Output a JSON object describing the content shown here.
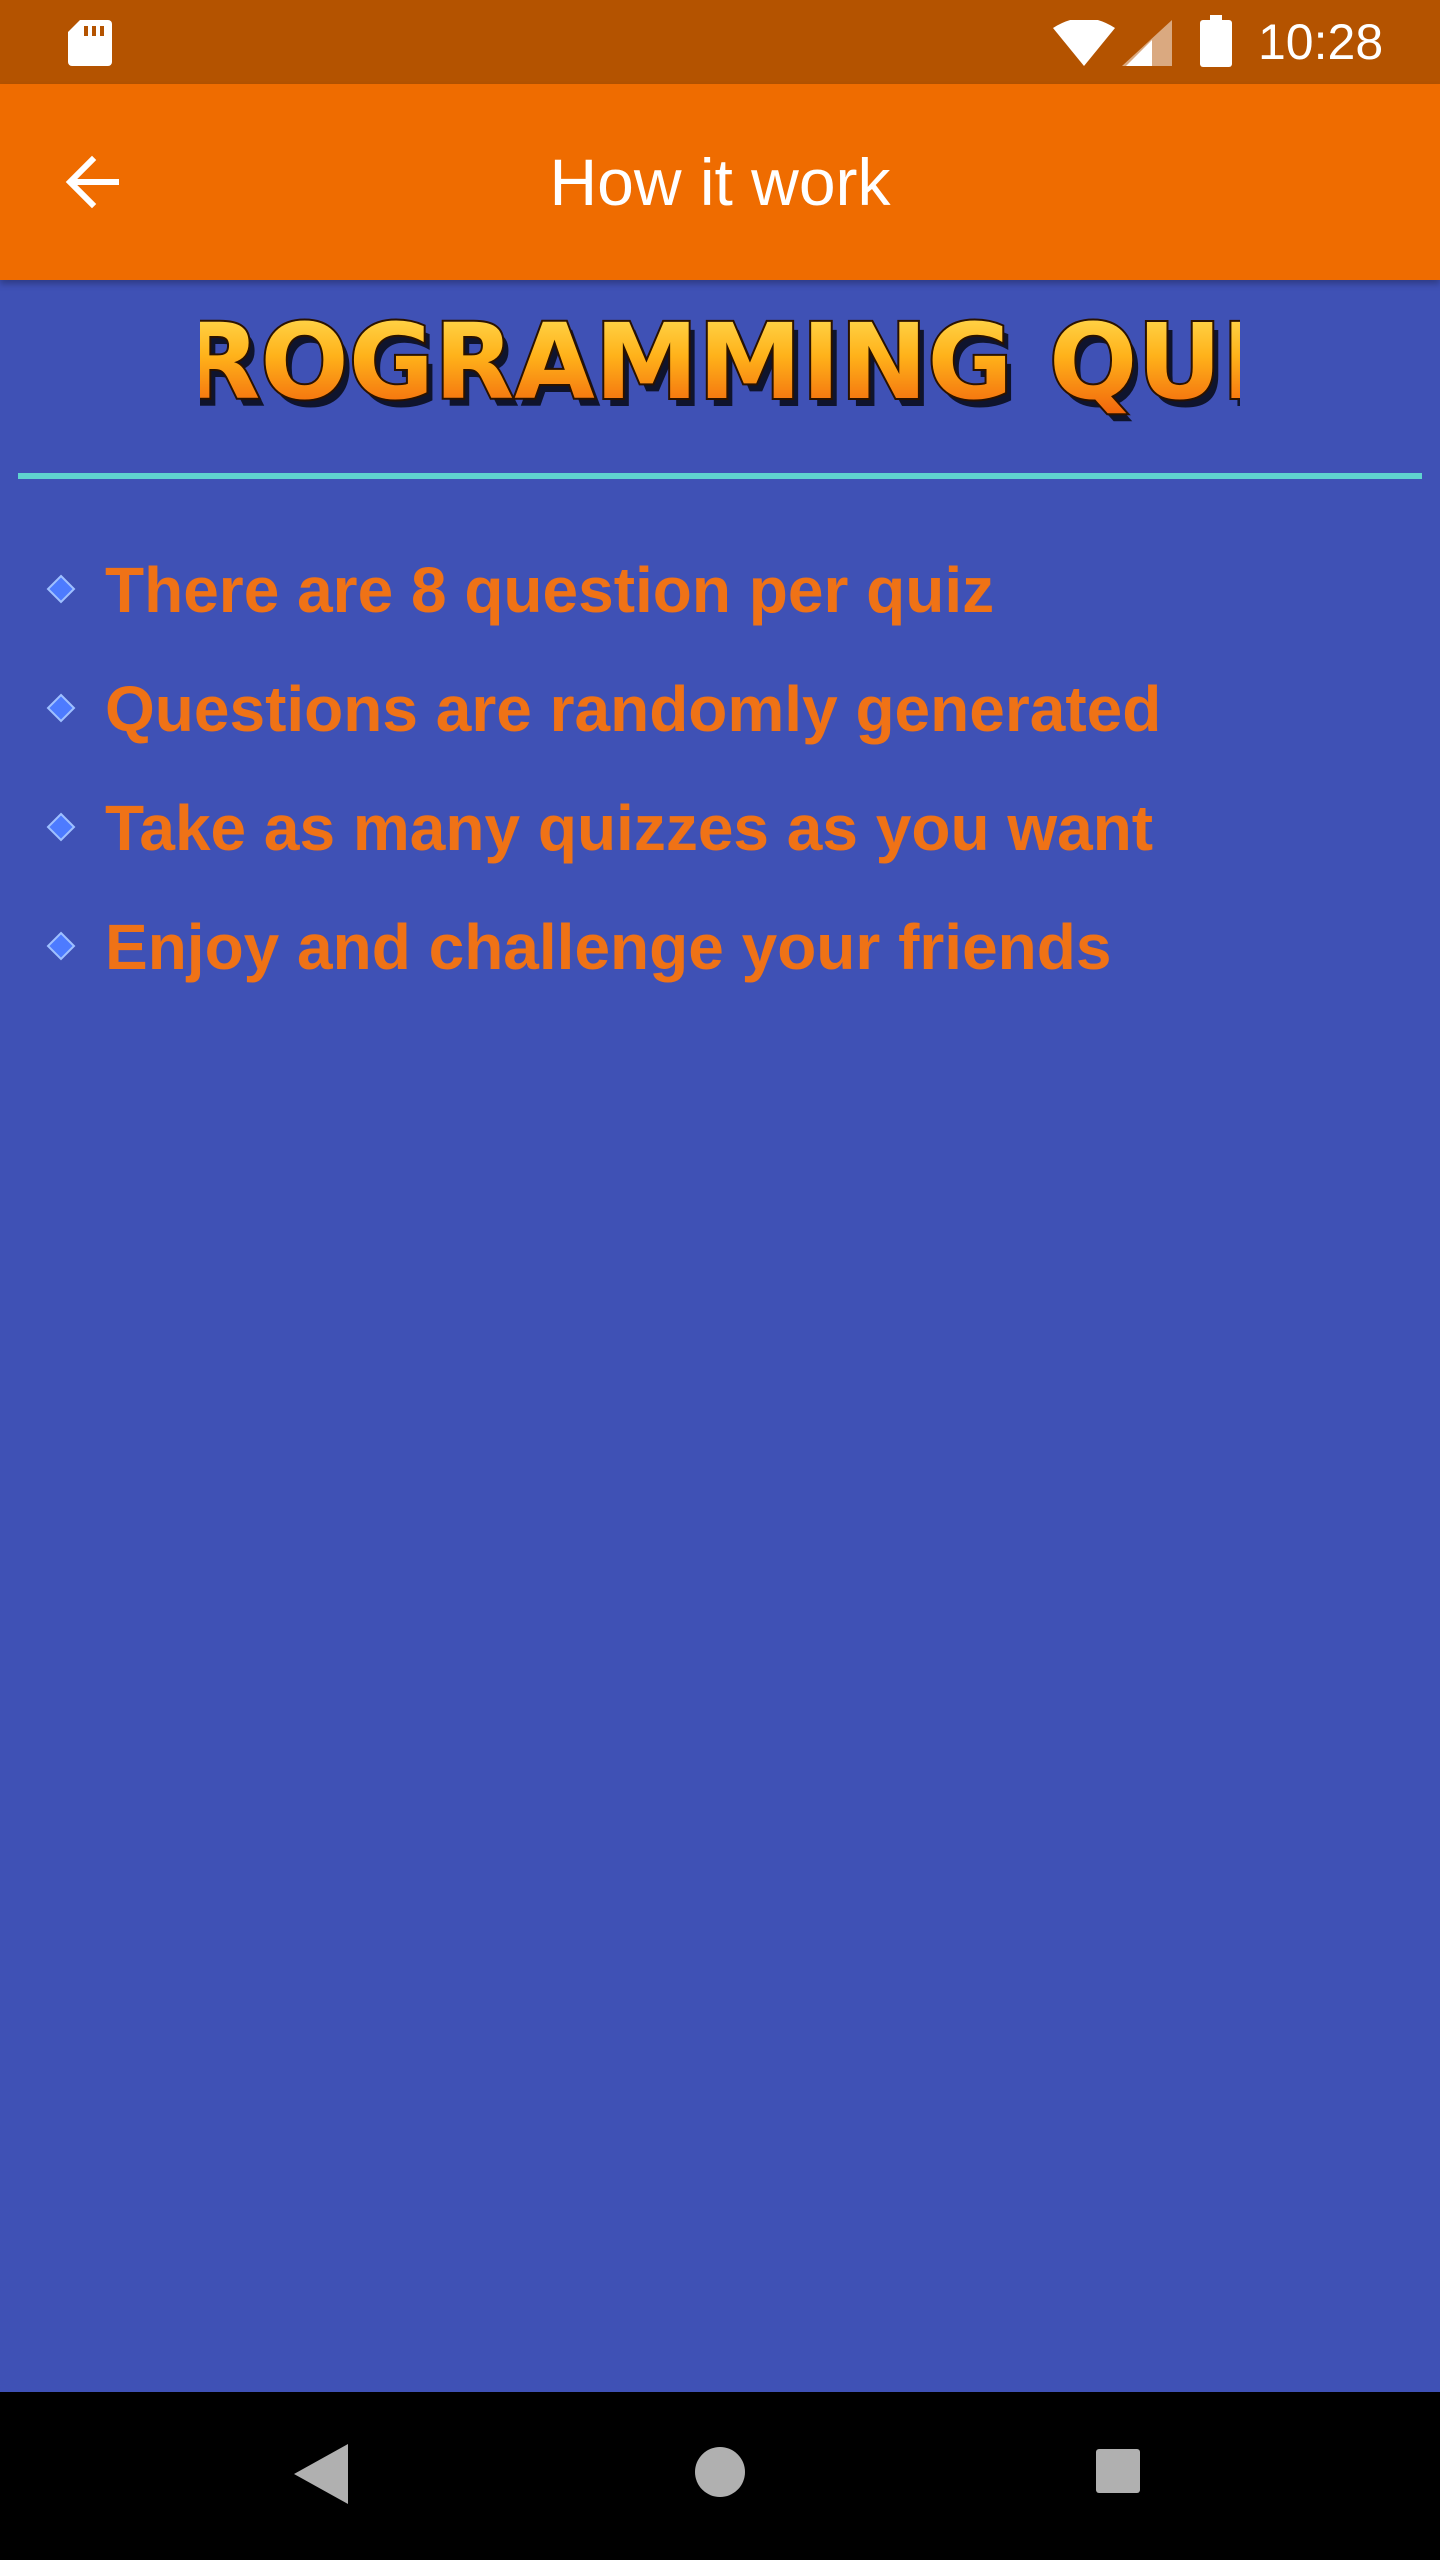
{
  "status_bar": {
    "time": "10:28",
    "icons": [
      "sd-card-icon",
      "wifi-icon",
      "cell-signal-icon",
      "battery-icon"
    ]
  },
  "app_bar": {
    "title": "How it work",
    "back_icon": "arrow-back-icon"
  },
  "logo": {
    "text": "PROGRAMMING QUIZ"
  },
  "rules": [
    {
      "text": "There are 8 question per quiz",
      "icon": "diamond-bullet-icon"
    },
    {
      "text": "Questions are randomly generated",
      "icon": "diamond-bullet-icon"
    },
    {
      "text": "Take as many quizzes as you want",
      "icon": "diamond-bullet-icon"
    },
    {
      "text": "Enjoy and challenge your friends",
      "icon": "diamond-bullet-icon"
    }
  ],
  "nav_bar": {
    "icons": [
      "nav-back-icon",
      "nav-home-icon",
      "nav-recents-icon"
    ]
  },
  "colors": {
    "status_bar": "#b45300",
    "app_bar": "#ef6c00",
    "background": "#3f51b5",
    "divider": "#5fd3cf",
    "rule_text": "#ef7216",
    "nav_bar": "#000000"
  }
}
